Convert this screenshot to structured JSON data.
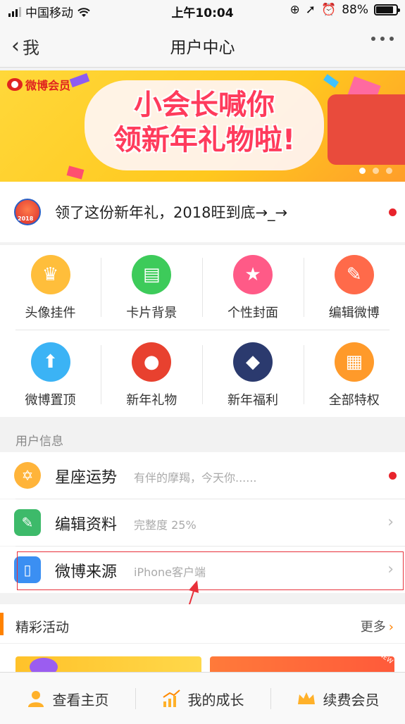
{
  "status_bar": {
    "carrier": "中国移动",
    "time": "上午10:04",
    "battery": "88%"
  },
  "nav": {
    "back_label": "我",
    "title": "用户中心"
  },
  "banner": {
    "logo": "微博会员",
    "headline_line1": "小会长喊你",
    "headline_line2": "领新年礼物啦!",
    "slide_count": 3,
    "active_slide": 1
  },
  "notice": {
    "text": "领了这份新年礼，2018旺到底→_→"
  },
  "privileges": [
    {
      "label": "头像挂件",
      "icon": "crown-icon",
      "color": "#ffbe3b"
    },
    {
      "label": "卡片背景",
      "icon": "card-icon",
      "color": "#3dcb5a"
    },
    {
      "label": "个性封面",
      "icon": "shirt-icon",
      "color": "#ff5a87"
    },
    {
      "label": "编辑微博",
      "icon": "pencil-icon",
      "color": "#ff6a4a"
    },
    {
      "label": "微博置顶",
      "icon": "arrow-up-icon",
      "color": "#3bb3f5"
    },
    {
      "label": "新年礼物",
      "icon": "new-year-gift-icon",
      "color": "#e8412f"
    },
    {
      "label": "新年福利",
      "icon": "new-year-bonus-icon",
      "color": "#2b3a6e"
    },
    {
      "label": "全部特权",
      "icon": "grid-icon",
      "color": "#ff9a2a"
    }
  ],
  "user_info": {
    "header": "用户信息",
    "rows": [
      {
        "title": "星座运势",
        "subtitle": "有伴的摩羯，今天你......",
        "icon": "star-sign-icon",
        "color": "#ffb43a"
      },
      {
        "title": "编辑资料",
        "subtitle": "完整度 25%",
        "icon": "edit-profile-icon",
        "color": "#3dba6a"
      },
      {
        "title": "微博来源",
        "subtitle": "iPhone客户端",
        "icon": "phone-icon",
        "color": "#3b8ff2"
      }
    ]
  },
  "activities": {
    "title": "精彩活动",
    "more_label": "更多",
    "more_arrow": "›"
  },
  "tab_bar": [
    {
      "label": "查看主页",
      "icon": "person-icon"
    },
    {
      "label": "我的成长",
      "icon": "growth-chart-icon"
    },
    {
      "label": "续费会员",
      "icon": "crown-icon"
    }
  ]
}
